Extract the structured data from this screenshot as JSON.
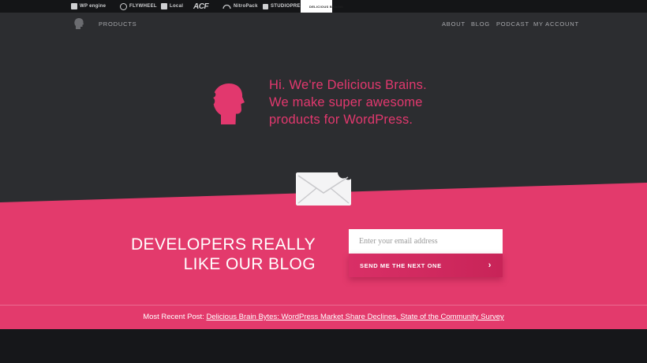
{
  "brand_bar": {
    "items": [
      {
        "name": "wp-engine",
        "label": "WP engine"
      },
      {
        "name": "flywheel",
        "label": "FLYWHEEL"
      },
      {
        "name": "local",
        "label": "Local"
      },
      {
        "name": "acf",
        "label": "ACF"
      },
      {
        "name": "nitropack",
        "label": "NitroPack"
      },
      {
        "name": "studiopress",
        "label": "STUDIOPRESS"
      },
      {
        "name": "delicious-brains",
        "label": "DELICIOUS BRAINS"
      }
    ]
  },
  "nav": {
    "products": "PRODUCTS",
    "about": "ABOUT",
    "blog": "BLOG",
    "podcast": "PODCAST",
    "account": "MY ACCOUNT"
  },
  "hero": {
    "line1": "Hi. We're Delicious Brains.",
    "line2": "We make super awesome",
    "line3": "products for WordPress."
  },
  "newsletter": {
    "heading_line1": "DEVELOPERS REALLY",
    "heading_line2": "LIKE OUR BLOG",
    "email_placeholder": "Enter your email address",
    "button_label": "SEND ME THE NEXT ONE",
    "button_icon": "chevron-right-icon"
  },
  "recent_post": {
    "prefix": "Most Recent Post:",
    "title": "Delicious Brain Bytes: WordPress Market Share Declines, State of the Community Survey"
  },
  "colors": {
    "accent_pink": "#e2386e",
    "band_pink": "#e33a6c",
    "hero_dark": "#2c2d30"
  }
}
